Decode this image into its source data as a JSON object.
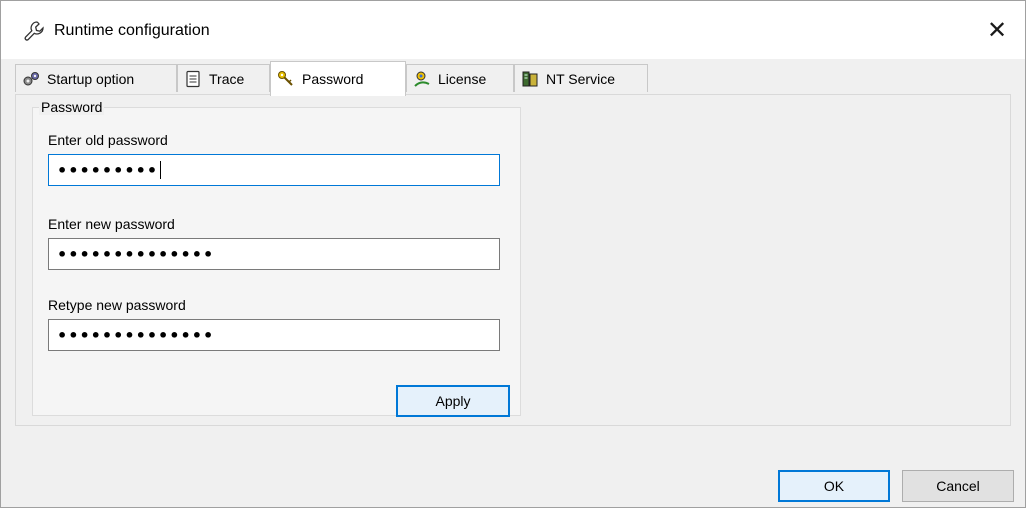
{
  "window": {
    "title": "Runtime configuration",
    "close_glyph": "✕"
  },
  "tabs": [
    {
      "label": "Startup option",
      "icon": "gears-icon",
      "active": false
    },
    {
      "label": "Trace",
      "icon": "notepad-icon",
      "active": false
    },
    {
      "label": "Password",
      "icon": "keys-icon",
      "active": true
    },
    {
      "label": "License",
      "icon": "license-icon",
      "active": false
    },
    {
      "label": "NT Service",
      "icon": "server-icon",
      "active": false
    }
  ],
  "password_group": {
    "title": "Password",
    "old_label": "Enter old password",
    "old_value": "•••••••••",
    "new_label": "Enter new password",
    "new_value": "••••••••••••••",
    "retype_label": "Retype new password",
    "retype_value": "••••••••••••••",
    "apply_label": "Apply"
  },
  "footer": {
    "ok_label": "OK",
    "cancel_label": "Cancel"
  },
  "colors": {
    "accent": "#0078d7",
    "window_bg": "#f0f0f0"
  }
}
